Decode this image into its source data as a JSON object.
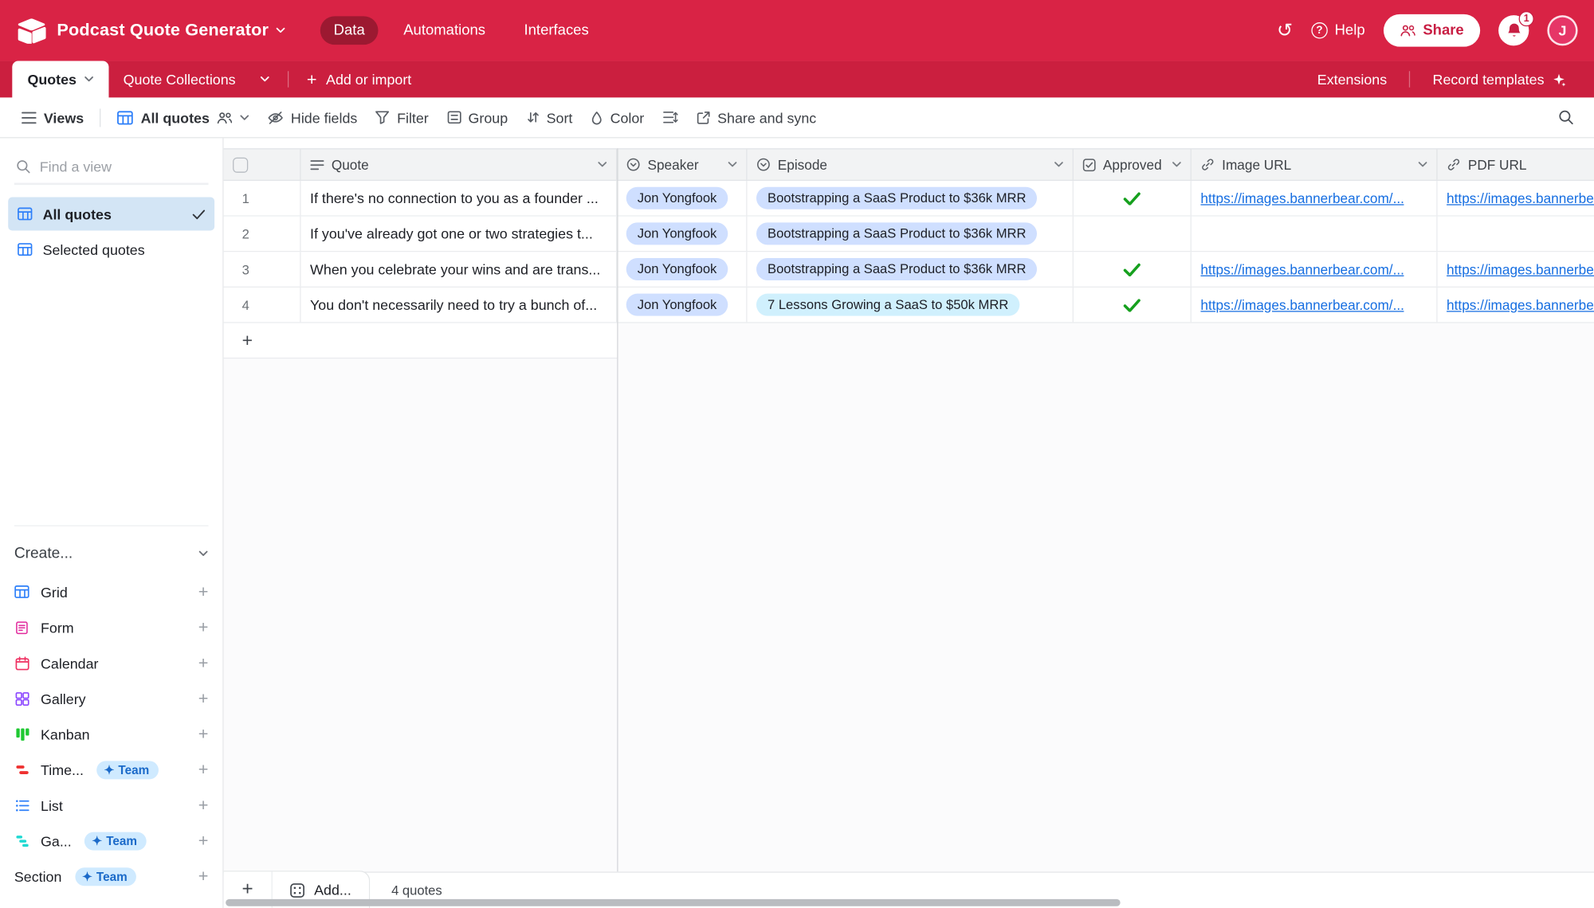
{
  "colors": {
    "topbar_red": "#d92345",
    "tabbar_red": "#cb1f3f",
    "accent_blue": "#2d7ff9",
    "pill_blue": "#cfdfff",
    "pill_cyan": "#d0f0fd",
    "link_blue": "#166ee1",
    "check_green": "#16a01e",
    "team_badge_bg": "#cfeaff",
    "team_badge_text": "#1b6ac9",
    "selected_view_bg": "#d3e5f5"
  },
  "topbar": {
    "title": "Podcast Quote Generator",
    "nav": [
      {
        "label": "Data",
        "active": true
      },
      {
        "label": "Automations",
        "active": false
      },
      {
        "label": "Interfaces",
        "active": false
      }
    ],
    "help_label": "Help",
    "share_label": "Share",
    "notification_count": "1",
    "avatar_initial": "J"
  },
  "tabbar": {
    "tabs": [
      {
        "label": "Quotes",
        "active": true
      },
      {
        "label": "Quote Collections",
        "active": false
      }
    ],
    "add_or_import": "Add or import",
    "extensions": "Extensions",
    "record_templates": "Record templates"
  },
  "toolbar": {
    "views_label": "Views",
    "current_view": "All quotes",
    "hide_fields": "Hide fields",
    "filter": "Filter",
    "group": "Group",
    "sort": "Sort",
    "color": "Color",
    "share_and_sync": "Share and sync"
  },
  "sidebar": {
    "find_placeholder": "Find a view",
    "views": [
      {
        "label": "All quotes",
        "selected": true
      },
      {
        "label": "Selected quotes",
        "selected": false
      }
    ],
    "create_label": "Create...",
    "create_items": [
      {
        "label": "Grid",
        "color": "#2d7ff9"
      },
      {
        "label": "Form",
        "color": "#e12b9d"
      },
      {
        "label": "Calendar",
        "color": "#ef3061"
      },
      {
        "label": "Gallery",
        "color": "#8b46ff"
      },
      {
        "label": "Kanban",
        "color": "#20c933"
      },
      {
        "label": "Time...",
        "color": "#ee3130",
        "badge": "Team"
      },
      {
        "label": "List",
        "color": "#2d7ff9"
      },
      {
        "label": "Ga...",
        "color": "#20d9d2",
        "badge": "Team"
      },
      {
        "label": "Section",
        "color": "",
        "badge": "Team"
      }
    ]
  },
  "grid": {
    "columns": [
      "Quote",
      "Speaker",
      "Episode",
      "Approved",
      "Image URL",
      "PDF URL"
    ],
    "rows": [
      {
        "num": "1",
        "quote": "If there's no connection to you as a founder ...",
        "speaker": "Jon Yongfook",
        "episode": "Bootstrapping a SaaS Product to $36k MRR",
        "approved": true,
        "image_url": "https://images.bannerbear.com/...",
        "pdf_url": "https://images.bannerbear.com/..."
      },
      {
        "num": "2",
        "quote": "If you've already got one or two strategies t...",
        "speaker": "Jon Yongfook",
        "episode": "Bootstrapping a SaaS Product to $36k MRR",
        "approved": false,
        "image_url": "",
        "pdf_url": ""
      },
      {
        "num": "3",
        "quote": "When you celebrate your wins and are trans...",
        "speaker": "Jon Yongfook",
        "episode": "Bootstrapping a SaaS Product to $36k MRR",
        "approved": true,
        "image_url": "https://images.bannerbear.com/...",
        "pdf_url": "https://images.bannerbear.com/..."
      },
      {
        "num": "4",
        "quote": "You don't necessarily need to try a bunch of...",
        "speaker": "Jon Yongfook",
        "episode": "7 Lessons Growing a SaaS to $50k MRR",
        "approved": true,
        "image_url": "https://images.bannerbear.com/...",
        "pdf_url": "https://images.bannerbear.com/..."
      }
    ],
    "footer": {
      "add_label": "Add...",
      "count_label": "4 quotes"
    }
  }
}
